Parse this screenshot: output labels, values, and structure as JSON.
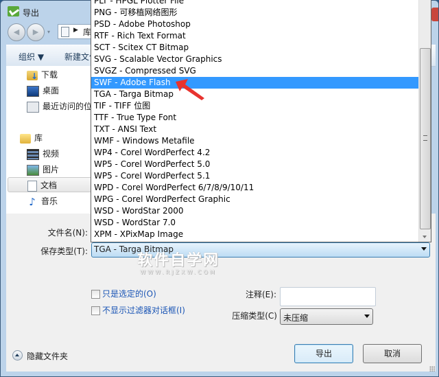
{
  "window": {
    "title": "导出",
    "breadcrumb": "库",
    "nav_dropdown": "▾"
  },
  "toolbar": {
    "organize": "组织 ▼",
    "new_folder": "新建文件夹"
  },
  "sidebar": {
    "items": [
      {
        "label": "下载",
        "icon": "download-folder-icon"
      },
      {
        "label": "桌面",
        "icon": "desktop-icon"
      },
      {
        "label": "最近访问的位置",
        "icon": "recent-places-icon"
      },
      {
        "label": "库",
        "icon": "library-icon"
      },
      {
        "label": "视频",
        "icon": "video-icon"
      },
      {
        "label": "图片",
        "icon": "picture-icon"
      },
      {
        "label": "文档",
        "icon": "document-icon",
        "selected": true
      },
      {
        "label": "音乐",
        "icon": "music-icon"
      }
    ]
  },
  "dropdown": {
    "items": [
      "PLT - HPGL Plotter File",
      "PNG - 可移植网络图形",
      "PSD - Adobe Photoshop",
      "RTF - Rich Text Format",
      "SCT - Scitex CT Bitmap",
      "SVG - Scalable Vector Graphics",
      "SVGZ - Compressed SVG",
      "SWF - Adobe Flash",
      "TGA - Targa Bitmap",
      "TIF - TIFF 位图",
      "TTF - True Type Font",
      "TXT - ANSI Text",
      "WMF - Windows Metafile",
      "WP4 - Corel WordPerfect 4.2",
      "WP5 - Corel WordPerfect 5.0",
      "WP5 - Corel WordPerfect 5.1",
      "WPD - Corel WordPerfect 6/7/8/9/10/11",
      "WPG - Corel WordPerfect Graphic",
      "WSD - WordStar 2000",
      "WSD - WordStar 7.0",
      "XPM - XPixMap Image"
    ],
    "highlighted": "SWF - Adobe Flash"
  },
  "form": {
    "filename_label": "文件名(N):",
    "filetype_label": "保存类型(T):",
    "filetype_value": "TGA - Targa Bitmap",
    "selected_only_label": "只是选定的(O)",
    "no_filter_dialog_label": "不显示过滤器对话框(I)",
    "note_label": "注释(E):",
    "note_value": "",
    "compression_label": "压缩类型(C)",
    "compression_value": "未压缩"
  },
  "footer": {
    "hide_folders": "隐藏文件夹",
    "export_button": "导出",
    "cancel_button": "取消"
  },
  "watermark": {
    "title": "软件自学网",
    "url": "WWW.RJZXW.COM"
  },
  "colors": {
    "highlight": "#3399ff",
    "annotation_arrow": "#e8332f",
    "link_text": "#1a55b5"
  }
}
